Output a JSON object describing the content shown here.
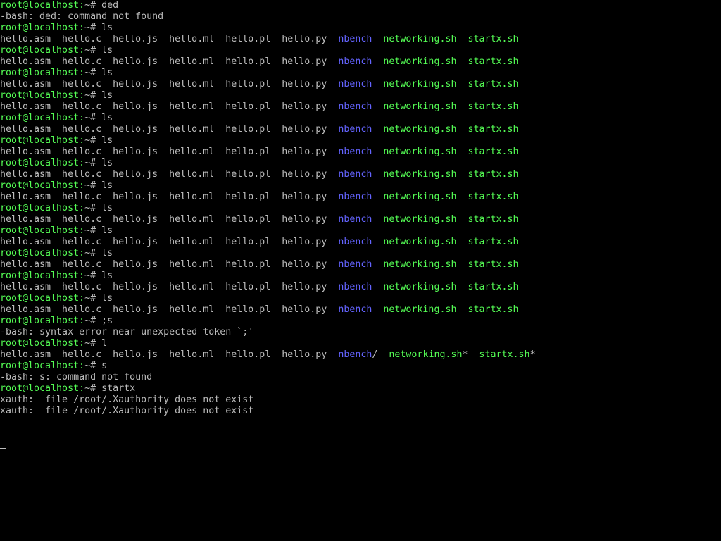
{
  "colors": {
    "background": "#000000",
    "text": "#bcbcbc",
    "prompt": "#54fc54",
    "directory": "#6464ff",
    "executable": "#54fc54"
  },
  "lines": [
    [
      {
        "t": "root@localhost:",
        "c": "prompt"
      },
      {
        "t": "~# ded",
        "c": "text"
      }
    ],
    [
      {
        "t": "-bash: ded: command not found",
        "c": "text"
      }
    ],
    [
      {
        "t": "root@localhost:",
        "c": "prompt"
      },
      {
        "t": "~# ls",
        "c": "text"
      }
    ],
    [
      {
        "t": "hello.asm  hello.c  hello.js  hello.ml  hello.pl  hello.py  ",
        "c": "text"
      },
      {
        "t": "nbench",
        "c": "dir"
      },
      {
        "t": "  ",
        "c": "text"
      },
      {
        "t": "networking.sh",
        "c": "exec"
      },
      {
        "t": "  ",
        "c": "text"
      },
      {
        "t": "startx.sh",
        "c": "exec"
      }
    ],
    [
      {
        "t": "root@localhost:",
        "c": "prompt"
      },
      {
        "t": "~# ls",
        "c": "text"
      }
    ],
    [
      {
        "t": "hello.asm  hello.c  hello.js  hello.ml  hello.pl  hello.py  ",
        "c": "text"
      },
      {
        "t": "nbench",
        "c": "dir"
      },
      {
        "t": "  ",
        "c": "text"
      },
      {
        "t": "networking.sh",
        "c": "exec"
      },
      {
        "t": "  ",
        "c": "text"
      },
      {
        "t": "startx.sh",
        "c": "exec"
      }
    ],
    [
      {
        "t": "root@localhost:",
        "c": "prompt"
      },
      {
        "t": "~# ls",
        "c": "text"
      }
    ],
    [
      {
        "t": "hello.asm  hello.c  hello.js  hello.ml  hello.pl  hello.py  ",
        "c": "text"
      },
      {
        "t": "nbench",
        "c": "dir"
      },
      {
        "t": "  ",
        "c": "text"
      },
      {
        "t": "networking.sh",
        "c": "exec"
      },
      {
        "t": "  ",
        "c": "text"
      },
      {
        "t": "startx.sh",
        "c": "exec"
      }
    ],
    [
      {
        "t": "root@localhost:",
        "c": "prompt"
      },
      {
        "t": "~# ls",
        "c": "text"
      }
    ],
    [
      {
        "t": "hello.asm  hello.c  hello.js  hello.ml  hello.pl  hello.py  ",
        "c": "text"
      },
      {
        "t": "nbench",
        "c": "dir"
      },
      {
        "t": "  ",
        "c": "text"
      },
      {
        "t": "networking.sh",
        "c": "exec"
      },
      {
        "t": "  ",
        "c": "text"
      },
      {
        "t": "startx.sh",
        "c": "exec"
      }
    ],
    [
      {
        "t": "root@localhost:",
        "c": "prompt"
      },
      {
        "t": "~# ls",
        "c": "text"
      }
    ],
    [
      {
        "t": "hello.asm  hello.c  hello.js  hello.ml  hello.pl  hello.py  ",
        "c": "text"
      },
      {
        "t": "nbench",
        "c": "dir"
      },
      {
        "t": "  ",
        "c": "text"
      },
      {
        "t": "networking.sh",
        "c": "exec"
      },
      {
        "t": "  ",
        "c": "text"
      },
      {
        "t": "startx.sh",
        "c": "exec"
      }
    ],
    [
      {
        "t": "root@localhost:",
        "c": "prompt"
      },
      {
        "t": "~# ls",
        "c": "text"
      }
    ],
    [
      {
        "t": "hello.asm  hello.c  hello.js  hello.ml  hello.pl  hello.py  ",
        "c": "text"
      },
      {
        "t": "nbench",
        "c": "dir"
      },
      {
        "t": "  ",
        "c": "text"
      },
      {
        "t": "networking.sh",
        "c": "exec"
      },
      {
        "t": "  ",
        "c": "text"
      },
      {
        "t": "startx.sh",
        "c": "exec"
      }
    ],
    [
      {
        "t": "root@localhost:",
        "c": "prompt"
      },
      {
        "t": "~# ls",
        "c": "text"
      }
    ],
    [
      {
        "t": "hello.asm  hello.c  hello.js  hello.ml  hello.pl  hello.py  ",
        "c": "text"
      },
      {
        "t": "nbench",
        "c": "dir"
      },
      {
        "t": "  ",
        "c": "text"
      },
      {
        "t": "networking.sh",
        "c": "exec"
      },
      {
        "t": "  ",
        "c": "text"
      },
      {
        "t": "startx.sh",
        "c": "exec"
      }
    ],
    [
      {
        "t": "root@localhost:",
        "c": "prompt"
      },
      {
        "t": "~# ls",
        "c": "text"
      }
    ],
    [
      {
        "t": "hello.asm  hello.c  hello.js  hello.ml  hello.pl  hello.py  ",
        "c": "text"
      },
      {
        "t": "nbench",
        "c": "dir"
      },
      {
        "t": "  ",
        "c": "text"
      },
      {
        "t": "networking.sh",
        "c": "exec"
      },
      {
        "t": "  ",
        "c": "text"
      },
      {
        "t": "startx.sh",
        "c": "exec"
      }
    ],
    [
      {
        "t": "root@localhost:",
        "c": "prompt"
      },
      {
        "t": "~# ls",
        "c": "text"
      }
    ],
    [
      {
        "t": "hello.asm  hello.c  hello.js  hello.ml  hello.pl  hello.py  ",
        "c": "text"
      },
      {
        "t": "nbench",
        "c": "dir"
      },
      {
        "t": "  ",
        "c": "text"
      },
      {
        "t": "networking.sh",
        "c": "exec"
      },
      {
        "t": "  ",
        "c": "text"
      },
      {
        "t": "startx.sh",
        "c": "exec"
      }
    ],
    [
      {
        "t": "root@localhost:",
        "c": "prompt"
      },
      {
        "t": "~# ls",
        "c": "text"
      }
    ],
    [
      {
        "t": "hello.asm  hello.c  hello.js  hello.ml  hello.pl  hello.py  ",
        "c": "text"
      },
      {
        "t": "nbench",
        "c": "dir"
      },
      {
        "t": "  ",
        "c": "text"
      },
      {
        "t": "networking.sh",
        "c": "exec"
      },
      {
        "t": "  ",
        "c": "text"
      },
      {
        "t": "startx.sh",
        "c": "exec"
      }
    ],
    [
      {
        "t": "root@localhost:",
        "c": "prompt"
      },
      {
        "t": "~# ls",
        "c": "text"
      }
    ],
    [
      {
        "t": "hello.asm  hello.c  hello.js  hello.ml  hello.pl  hello.py  ",
        "c": "text"
      },
      {
        "t": "nbench",
        "c": "dir"
      },
      {
        "t": "  ",
        "c": "text"
      },
      {
        "t": "networking.sh",
        "c": "exec"
      },
      {
        "t": "  ",
        "c": "text"
      },
      {
        "t": "startx.sh",
        "c": "exec"
      }
    ],
    [
      {
        "t": "root@localhost:",
        "c": "prompt"
      },
      {
        "t": "~# ls",
        "c": "text"
      }
    ],
    [
      {
        "t": "hello.asm  hello.c  hello.js  hello.ml  hello.pl  hello.py  ",
        "c": "text"
      },
      {
        "t": "nbench",
        "c": "dir"
      },
      {
        "t": "  ",
        "c": "text"
      },
      {
        "t": "networking.sh",
        "c": "exec"
      },
      {
        "t": "  ",
        "c": "text"
      },
      {
        "t": "startx.sh",
        "c": "exec"
      }
    ],
    [
      {
        "t": "root@localhost:",
        "c": "prompt"
      },
      {
        "t": "~# ls",
        "c": "text"
      }
    ],
    [
      {
        "t": "hello.asm  hello.c  hello.js  hello.ml  hello.pl  hello.py  ",
        "c": "text"
      },
      {
        "t": "nbench",
        "c": "dir"
      },
      {
        "t": "  ",
        "c": "text"
      },
      {
        "t": "networking.sh",
        "c": "exec"
      },
      {
        "t": "  ",
        "c": "text"
      },
      {
        "t": "startx.sh",
        "c": "exec"
      }
    ],
    [
      {
        "t": "root@localhost:",
        "c": "prompt"
      },
      {
        "t": "~# ;s",
        "c": "text"
      }
    ],
    [
      {
        "t": "-bash: syntax error near unexpected token `;'",
        "c": "text"
      }
    ],
    [
      {
        "t": "root@localhost:",
        "c": "prompt"
      },
      {
        "t": "~# l",
        "c": "text"
      }
    ],
    [
      {
        "t": "hello.asm  hello.c  hello.js  hello.ml  hello.pl  hello.py  ",
        "c": "text"
      },
      {
        "t": "nbench",
        "c": "dir"
      },
      {
        "t": "/  ",
        "c": "text"
      },
      {
        "t": "networking.sh",
        "c": "exec"
      },
      {
        "t": "*  ",
        "c": "text"
      },
      {
        "t": "startx.sh",
        "c": "exec"
      },
      {
        "t": "*",
        "c": "text"
      }
    ],
    [
      {
        "t": "root@localhost:",
        "c": "prompt"
      },
      {
        "t": "~# s",
        "c": "text"
      }
    ],
    [
      {
        "t": "-bash: s: command not found",
        "c": "text"
      }
    ],
    [
      {
        "t": "root@localhost:",
        "c": "prompt"
      },
      {
        "t": "~# startx",
        "c": "text"
      }
    ],
    [
      {
        "t": "xauth:  file /root/.Xauthority does not exist",
        "c": "text"
      }
    ],
    [
      {
        "t": "xauth:  file /root/.Xauthority does not exist",
        "c": "text"
      }
    ],
    [],
    []
  ]
}
